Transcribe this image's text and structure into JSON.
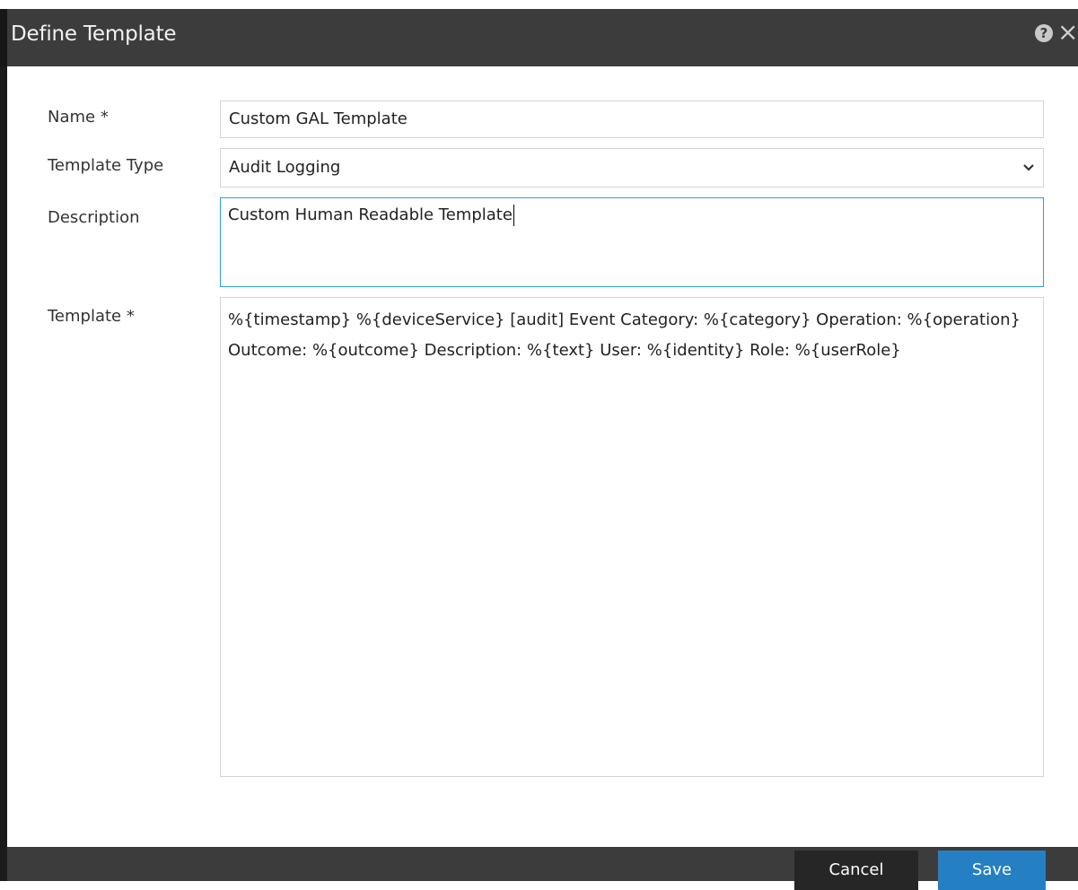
{
  "window": {
    "title": "Define Template"
  },
  "icons": {
    "help": "question-circle-icon",
    "close": "close-icon",
    "dropdown": "chevron-down-icon"
  },
  "form": {
    "name": {
      "label": "Name *",
      "value": "Custom GAL Template"
    },
    "template_type": {
      "label": "Template Type",
      "value": "Audit Logging"
    },
    "description": {
      "label": "Description",
      "value": "Custom Human Readable Template"
    },
    "template": {
      "label": "Template *",
      "value": "%{timestamp} %{deviceService} [audit] Event Category: %{category} Operation: %{operation} Outcome: %{outcome} Description: %{text} User: %{identity} Role: %{userRole}"
    }
  },
  "footer": {
    "cancel_label": "Cancel",
    "save_label": "Save"
  },
  "colors": {
    "titlebar_bg": "#3c3c3c",
    "save_button": "#2580c3",
    "cancel_button": "#262626",
    "focus_border": "#2f9fd8"
  }
}
